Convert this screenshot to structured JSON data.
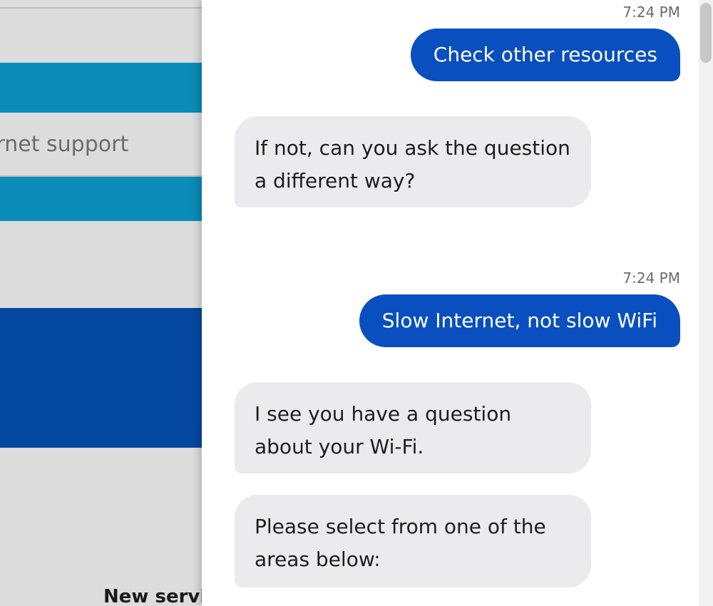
{
  "background_page": {
    "search_text": "ernet support",
    "footer_heading": "New servic"
  },
  "chat": {
    "messages": [
      {
        "time": "7:24 PM",
        "user": "Check other resources"
      },
      {
        "agent": "If not, can you ask the question a different way?"
      },
      {
        "time": "7:24 PM",
        "user": "Slow Internet, not slow WiFi"
      },
      {
        "agent": "I see you have a question about your Wi-Fi."
      },
      {
        "agent": "Please select from one of the areas below:"
      }
    ]
  },
  "colors": {
    "user_bubble": "#0a4fbf",
    "agent_bubble": "#ebebed",
    "bg_band": "#0a8bb8",
    "bg_block": "#0448a0"
  }
}
